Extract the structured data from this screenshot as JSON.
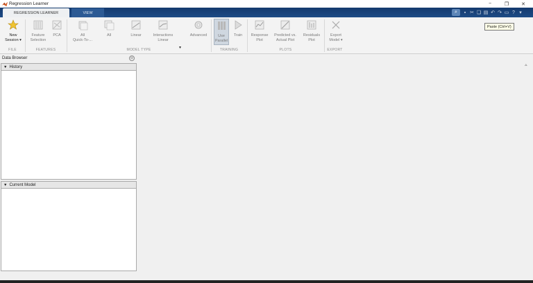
{
  "window": {
    "title": "Regression Learner",
    "controls": [
      "−",
      "❐",
      "✕"
    ]
  },
  "tabs": [
    {
      "label": "REGRESSION LEARNER"
    },
    {
      "label": "VIEW"
    }
  ],
  "ribbon": {
    "buttons": {
      "new_session": "New\nSession ▾",
      "feature_selection": "Feature\nSelection",
      "pca": "PCA",
      "all_quick": "All\nQuick-To-...",
      "all": "All",
      "linear": "Linear",
      "interactions_linear": "Interactions\nLinear",
      "advanced": "Advanced",
      "use_parallel": "Use\nParallel",
      "train": "Train",
      "response_plot": "Response\nPlot",
      "predicted_vs_actual": "Predicted vs.\nActual Plot",
      "residuals_plot": "Residuals\nPlot",
      "export_model": "Export\nModel ▾"
    },
    "sections": {
      "file": "FILE",
      "features": "FEATURES",
      "model_type": "MODEL TYPE",
      "training": "TRAINING",
      "plots": "PLOTS",
      "export": "EXPORT"
    },
    "gallery_more": "▾",
    "tooltip": "Paste (Ctrl+V)"
  },
  "data_browser": {
    "title": "Data Browser",
    "history_label": "History",
    "current_model_label": "Current Model"
  },
  "icons": {
    "app": "regression-learner-icon",
    "triangle": "▼",
    "collapse": "⊙"
  },
  "colors": {
    "tabstrip": "#1d4b85",
    "accent_gold": "#e9b72a"
  }
}
